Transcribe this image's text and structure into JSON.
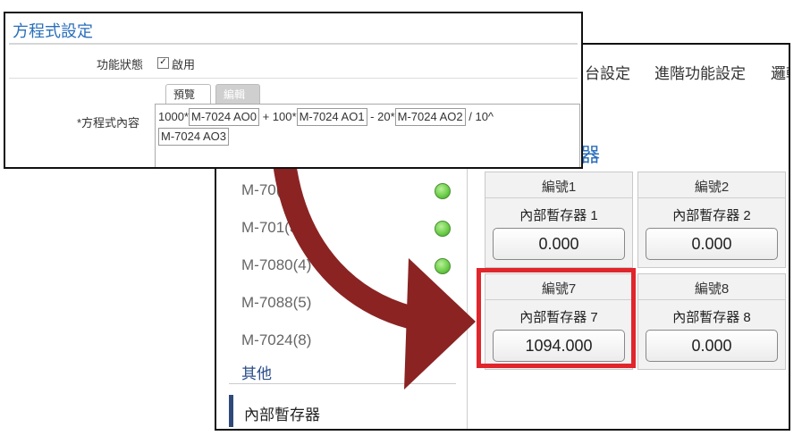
{
  "front_dialog": {
    "title": "方程式設定",
    "status_label": "功能狀態",
    "enable_text": "啟用",
    "checkbox_mark": "✓",
    "formula_label": "*方程式內容",
    "tabs": [
      "預覽",
      "編輯"
    ],
    "formula": {
      "t1": "1000*",
      "c1": "M-7024 AO0",
      "t2": " + 100*",
      "c2": "M-7024 AO1",
      "t3": " - 20*",
      "c3": "M-7024 AO2",
      "t4": " / 10^",
      "c4": "M-7024 AO3"
    }
  },
  "back_window": {
    "nav": [
      "台設定",
      "進階功能設定",
      "邏輯"
    ],
    "glyph_fragment": "器",
    "modules": [
      "M-70(2)",
      "M-701(3)",
      "M-7080(4)",
      "M-7088(5)",
      "M-7024(8)"
    ],
    "others_heading": "其他",
    "internal_item": "內部暫存器",
    "registers": [
      {
        "title": "編號1",
        "name": "內部暫存器 1",
        "value": "0.000"
      },
      {
        "title": "編號2",
        "name": "內部暫存器 2",
        "value": "0.000"
      },
      {
        "title": "編號7",
        "name": "內部暫存器 7",
        "value": "1094.000"
      },
      {
        "title": "編號8",
        "name": "內部暫存器 8",
        "value": "0.000"
      }
    ]
  },
  "colors": {
    "highlight": "#e0262c",
    "arrow": "#8b2323",
    "title_blue": "#2a6ebb",
    "led_green": "#6fcf4b"
  }
}
